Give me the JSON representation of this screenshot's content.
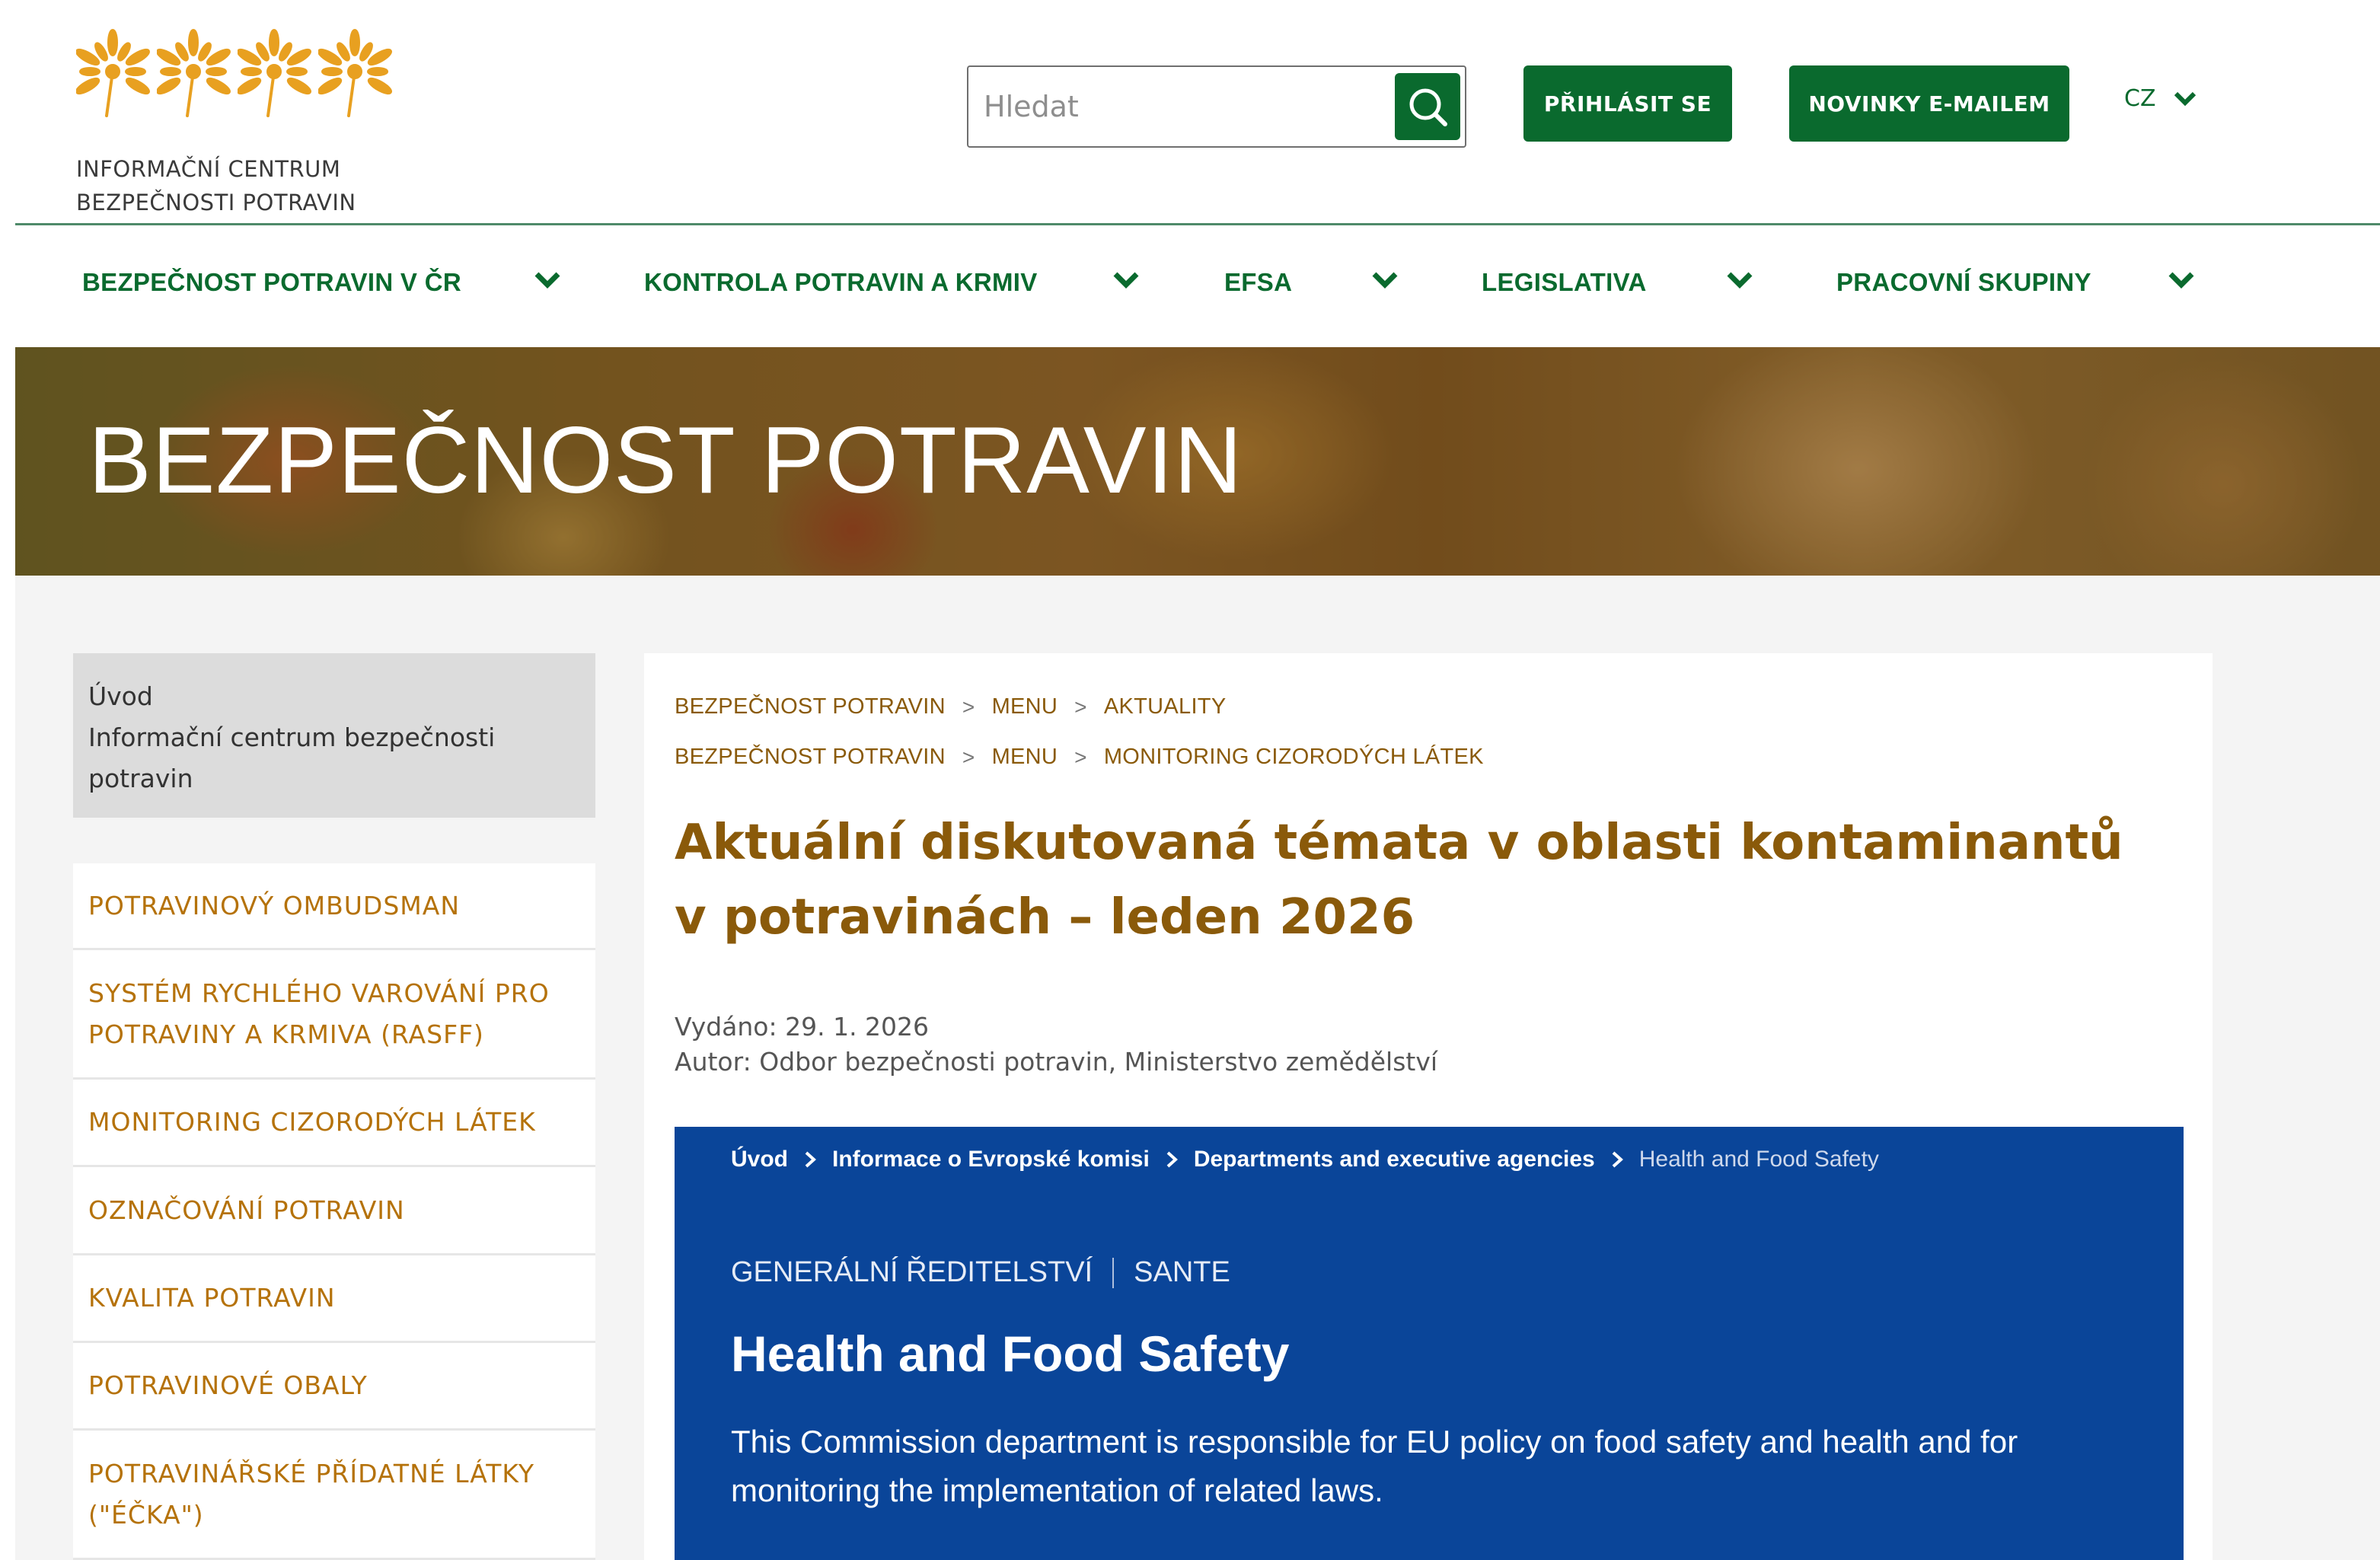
{
  "header": {
    "logo": {
      "line1": "INFORMAČNÍ CENTRUM",
      "line2": "BEZPEČNOSTI POTRAVIN",
      "icon": "wheat-flower-icon"
    },
    "search": {
      "placeholder": "Hledat",
      "value": "",
      "icon": "search-icon"
    },
    "login_label": "PŘIHLÁSIT SE",
    "newsletter_label": "NOVINKY E-MAILEM",
    "language": "CZ",
    "accent_color": "#0a6a2e"
  },
  "nav": {
    "items": [
      {
        "label": "BEZPEČNOST POTRAVIN V ČR"
      },
      {
        "label": "KONTROLA POTRAVIN A KRMIV"
      },
      {
        "label": "EFSA"
      },
      {
        "label": "LEGISLATIVA"
      },
      {
        "label": "PRACOVNÍ SKUPINY"
      }
    ]
  },
  "banner": {
    "title": "BEZPEČNOST POTRAVIN"
  },
  "sidebar": {
    "top": {
      "line1": "Úvod",
      "line2": "Informační centrum bezpečnosti",
      "line3": "potravin"
    },
    "items": [
      {
        "lines": [
          "POTRAVINOVÝ OMBUDSMAN"
        ]
      },
      {
        "lines": [
          "SYSTÉM RYCHLÉHO VAROVÁNÍ PRO",
          "POTRAVINY A KRMIVA (RASFF)"
        ]
      },
      {
        "lines": [
          "MONITORING CIZORODÝCH LÁTEK"
        ]
      },
      {
        "lines": [
          "OZNAČOVÁNÍ POTRAVIN"
        ]
      },
      {
        "lines": [
          "KVALITA POTRAVIN"
        ]
      },
      {
        "lines": [
          "POTRAVINOVÉ OBALY"
        ]
      },
      {
        "lines": [
          "POTRAVINÁŘSKÉ PŘÍDATNÉ LÁTKY",
          "(\"ÉČKA\")"
        ]
      }
    ],
    "link_color": "#b5720a"
  },
  "main": {
    "breadcrumbs": [
      [
        "BEZPEČNOST POTRAVIN",
        "MENU",
        "AKTUALITY"
      ],
      [
        "BEZPEČNOST POTRAVIN",
        "MENU",
        "MONITORING CIZORODÝCH LÁTEK"
      ]
    ],
    "breadcrumb_separator": ">",
    "title_line1": "Aktuální diskutovaná témata v oblasti kontaminantů",
    "title_line2": "v potravinách – leden 2026",
    "published": "Vydáno: 29. 1. 2026",
    "author": "Autor: Odbor bezpečnosti potravin, Ministerstvo zemědělství",
    "title_color": "#8a5a0a"
  },
  "eu_embed": {
    "breadcrumbs": [
      "Úvod",
      "Informace o Evropské komisi",
      "Departments and executive agencies",
      "Health and Food Safety"
    ],
    "dg_label": "GENERÁLNÍ ŘEDITELSTVÍ",
    "dg_code": "SANTE",
    "title": "Health and Food Safety",
    "description": "This Commission department is responsible for EU policy on food safety and health and for monitoring the implementation of related laws.",
    "background_color": "#0a4599"
  }
}
